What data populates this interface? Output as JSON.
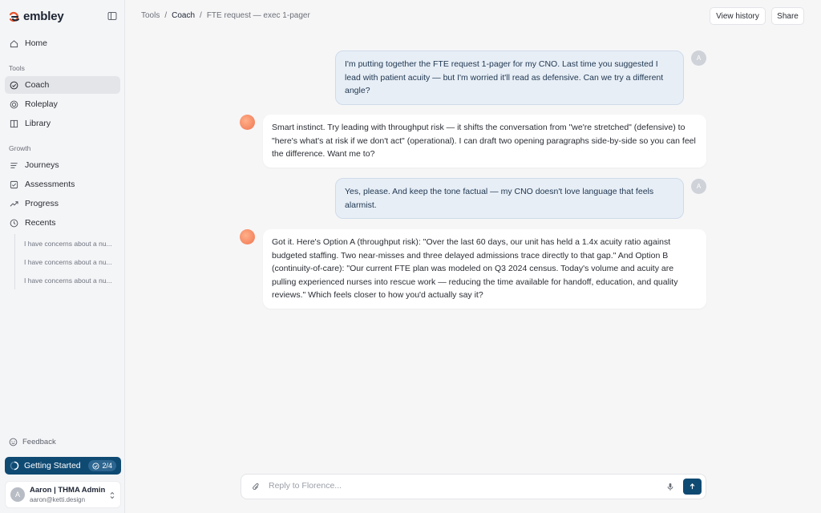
{
  "brand": {
    "name": "embley",
    "accent": "#e8522b"
  },
  "sidebar": {
    "home": "Home",
    "tools_label": "Tools",
    "tools": [
      "Coach",
      "Roleplay",
      "Library"
    ],
    "growth_label": "Growth",
    "growth": [
      "Journeys",
      "Assessments",
      "Progress",
      "Recents"
    ],
    "recents": [
      "I have concerns about a nu...",
      "I have concerns about a nu...",
      "I have concerns about a nu..."
    ],
    "feedback": "Feedback",
    "getting_started": {
      "label": "Getting Started",
      "progress": "2/4"
    },
    "user": {
      "initial": "A",
      "name": "Aaron | THMA Admin",
      "email": "aaron@ketti.design"
    }
  },
  "breadcrumb": {
    "section": "Tools",
    "page": "Coach",
    "doc": "FTE request — exec 1-pager"
  },
  "header": {
    "history": "View history",
    "share": "Share"
  },
  "messages": [
    {
      "role": "user",
      "text": "I'm putting together the FTE request 1-pager for my CNO. Last time you suggested I lead with patient acuity — but I'm worried it'll read as defensive. Can we try a different angle?"
    },
    {
      "role": "assistant",
      "text": "Smart instinct. Try leading with throughput risk — it shifts the conversation from \"we're stretched\" (defensive) to \"here's what's at risk if we don't act\" (operational). I can draft two opening paragraphs side-by-side so you can feel the difference. Want me to?"
    },
    {
      "role": "user",
      "text": "Yes, please. And keep the tone factual — my CNO doesn't love language that feels alarmist."
    },
    {
      "role": "assistant",
      "text": "Got it. Here's Option A (throughput risk): \"Over the last 60 days, our unit has held a 1.4x acuity ratio against budgeted staffing. Two near-misses and three delayed admissions trace directly to that gap.\" And Option B (continuity-of-care): \"Our current FTE plan was modeled on Q3 2024 census. Today's volume and acuity are pulling experienced nurses into rescue work — reducing the time available for handoff, education, and quality reviews.\" Which feels closer to how you'd actually say it?"
    }
  ],
  "user_avatar_initial": "A",
  "composer": {
    "placeholder": "Reply to Florence..."
  },
  "colors": {
    "primary": "#0f4a73",
    "user_bubble": "#e7eef6",
    "assistant_avatar": "#f0744f"
  }
}
